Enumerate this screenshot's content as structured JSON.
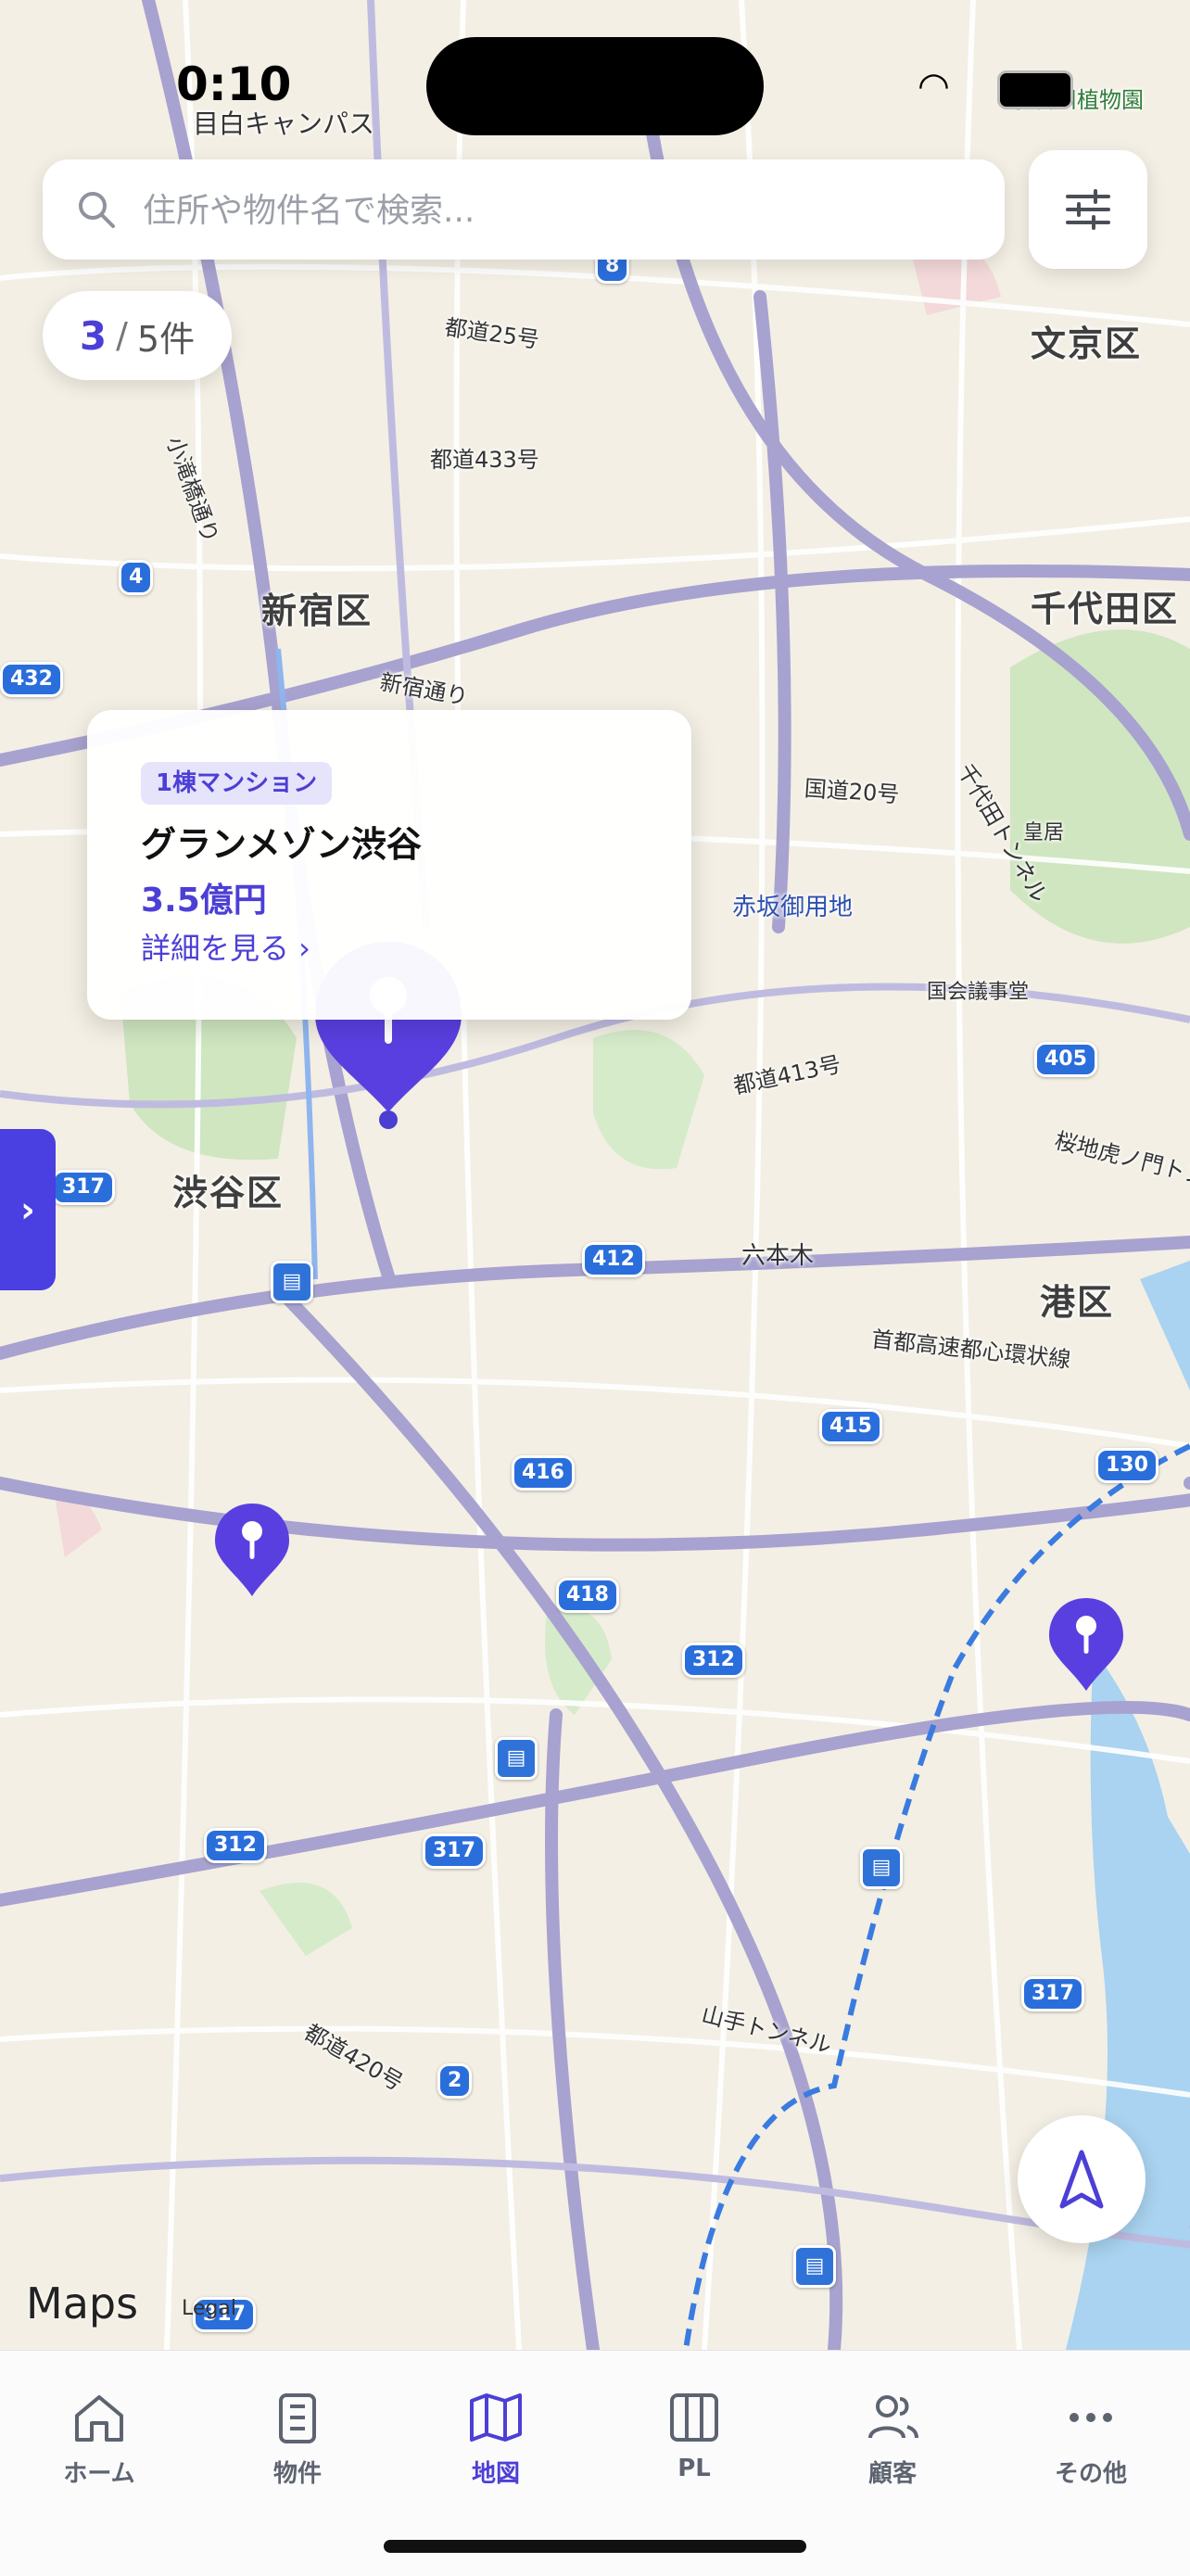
{
  "status_bar": {
    "time": "0:10"
  },
  "search": {
    "placeholder": "住所や物件名で検索..."
  },
  "results": {
    "current": "3",
    "separator": "/",
    "total": "5件"
  },
  "popup": {
    "tag": "1棟マンション",
    "name": "グランメゾン渋谷",
    "price": "3.5億円",
    "link": "詳細を見る ›"
  },
  "side_tab": {
    "label": "›"
  },
  "map": {
    "wards": [
      "文京区",
      "新宿区",
      "千代田区",
      "渋谷区",
      "港区"
    ],
    "roads": [
      "都道25号",
      "都道433号",
      "国道20号",
      "都道413号",
      "首都高速都心環状線",
      "山手トンネル",
      "都道420号",
      "新宿通り",
      "小滝橋通り",
      "千代田トンネル",
      "桜地虎ノ門トンネル"
    ],
    "places": [
      "赤坂御用地",
      "皇居",
      "国会議事堂",
      "六本木",
      "目白キャンパス",
      "小石川植物園"
    ],
    "route_shields": [
      "8",
      "4",
      "317",
      "412",
      "405",
      "415",
      "416",
      "130",
      "418",
      "312",
      "312",
      "317",
      "317",
      "2",
      "317",
      "432"
    ],
    "attribution": "Maps",
    "legal": "Legal"
  },
  "tabbar": {
    "items": [
      {
        "label": "ホーム",
        "icon": "home-icon",
        "active": false
      },
      {
        "label": "物件",
        "icon": "building-icon",
        "active": false
      },
      {
        "label": "地図",
        "icon": "map-icon",
        "active": true
      },
      {
        "label": "PL",
        "icon": "columns-icon",
        "active": false
      },
      {
        "label": "顧客",
        "icon": "users-icon",
        "active": false
      },
      {
        "label": "その他",
        "icon": "more-icon",
        "active": false
      }
    ]
  },
  "colors": {
    "accent": "#4c3fd6",
    "pin": "#5a3fe0",
    "side_tab": "#4a3fe0"
  }
}
